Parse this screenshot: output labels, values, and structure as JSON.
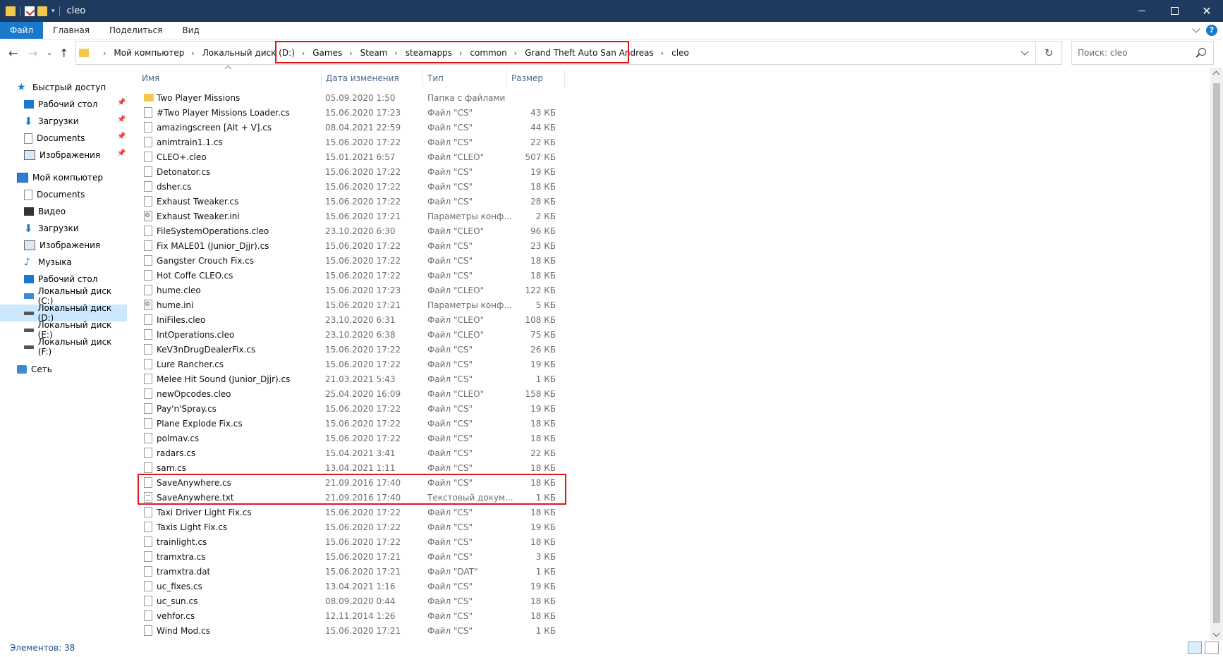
{
  "window": {
    "title": "cleo",
    "min_icon": "minimize-icon",
    "max_icon": "maximize-icon",
    "close_glyph": "✕"
  },
  "ribbon": {
    "tabs": [
      "Файл",
      "Главная",
      "Поделиться",
      "Вид"
    ]
  },
  "address": {
    "crumbs": [
      "Мой компьютер",
      "Локальный диск (D:)",
      "Games",
      "Steam",
      "steamapps",
      "common",
      "Grand Theft Auto San Andreas",
      "cleo"
    ],
    "refresh_glyph": "↻"
  },
  "search": {
    "placeholder": "Поиск: cleo"
  },
  "sidebar": {
    "quick_access": "Быстрый доступ",
    "quick_items": [
      {
        "label": "Рабочий стол",
        "icon": "desktop-icon"
      },
      {
        "label": "Загрузки",
        "icon": "downloads-icon"
      },
      {
        "label": "Documents",
        "icon": "documents-icon"
      },
      {
        "label": "Изображения",
        "icon": "pictures-icon"
      }
    ],
    "this_pc": "Мой компьютер",
    "pc_items": [
      {
        "label": "Documents",
        "icon": "documents-icon"
      },
      {
        "label": "Видео",
        "icon": "video-icon"
      },
      {
        "label": "Загрузки",
        "icon": "downloads-icon"
      },
      {
        "label": "Изображения",
        "icon": "pictures-icon"
      },
      {
        "label": "Музыка",
        "icon": "music-icon"
      },
      {
        "label": "Рабочий стол",
        "icon": "desktop-icon"
      },
      {
        "label": "Локальный диск (C:)",
        "icon": "drive-icon"
      },
      {
        "label": "Локальный диск (D:)",
        "icon": "drive-icon"
      },
      {
        "label": "Локальный диск (E:)",
        "icon": "drive-icon"
      },
      {
        "label": "Локальный диск (F:)",
        "icon": "drive-icon"
      }
    ],
    "network": "Сеть"
  },
  "columns": {
    "name": "Имя",
    "date": "Дата изменения",
    "type": "Тип",
    "size": "Размер"
  },
  "files": [
    {
      "name": "Two Player Missions",
      "date": "05.09.2020 1:50",
      "type": "Папка с файлами",
      "size": "",
      "kind": "folder"
    },
    {
      "name": "#Two Player Missions Loader.cs",
      "date": "15.06.2020 17:23",
      "type": "Файл \"CS\"",
      "size": "43 КБ",
      "kind": "file"
    },
    {
      "name": "amazingscreen [Alt + V].cs",
      "date": "08.04.2021 22:59",
      "type": "Файл \"CS\"",
      "size": "44 КБ",
      "kind": "file"
    },
    {
      "name": "animtrain1.1.cs",
      "date": "15.06.2020 17:22",
      "type": "Файл \"CS\"",
      "size": "22 КБ",
      "kind": "file"
    },
    {
      "name": "CLEO+.cleo",
      "date": "15.01.2021 6:57",
      "type": "Файл \"CLEO\"",
      "size": "507 КБ",
      "kind": "file"
    },
    {
      "name": "Detonator.cs",
      "date": "15.06.2020 17:22",
      "type": "Файл \"CS\"",
      "size": "19 КБ",
      "kind": "file"
    },
    {
      "name": "dsher.cs",
      "date": "15.06.2020 17:22",
      "type": "Файл \"CS\"",
      "size": "18 КБ",
      "kind": "file"
    },
    {
      "name": "Exhaust Tweaker.cs",
      "date": "15.06.2020 17:22",
      "type": "Файл \"CS\"",
      "size": "28 КБ",
      "kind": "file"
    },
    {
      "name": "Exhaust Tweaker.ini",
      "date": "15.06.2020 17:21",
      "type": "Параметры конф...",
      "size": "2 КБ",
      "kind": "ini"
    },
    {
      "name": "FileSystemOperations.cleo",
      "date": "23.10.2020 6:30",
      "type": "Файл \"CLEO\"",
      "size": "96 КБ",
      "kind": "file"
    },
    {
      "name": "Fix MALE01 (Junior_Djjr).cs",
      "date": "15.06.2020 17:22",
      "type": "Файл \"CS\"",
      "size": "23 КБ",
      "kind": "file"
    },
    {
      "name": "Gangster Crouch Fix.cs",
      "date": "15.06.2020 17:22",
      "type": "Файл \"CS\"",
      "size": "18 КБ",
      "kind": "file"
    },
    {
      "name": "Hot Coffe CLEO.cs",
      "date": "15.06.2020 17:22",
      "type": "Файл \"CS\"",
      "size": "18 КБ",
      "kind": "file"
    },
    {
      "name": "hume.cleo",
      "date": "15.06.2020 17:23",
      "type": "Файл \"CLEO\"",
      "size": "122 КБ",
      "kind": "file"
    },
    {
      "name": "hume.ini",
      "date": "15.06.2020 17:21",
      "type": "Параметры конф...",
      "size": "5 КБ",
      "kind": "ini"
    },
    {
      "name": "IniFiles.cleo",
      "date": "23.10.2020 6:31",
      "type": "Файл \"CLEO\"",
      "size": "108 КБ",
      "kind": "file"
    },
    {
      "name": "IntOperations.cleo",
      "date": "23.10.2020 6:38",
      "type": "Файл \"CLEO\"",
      "size": "75 КБ",
      "kind": "file"
    },
    {
      "name": "KeV3nDrugDealerFix.cs",
      "date": "15.06.2020 17:22",
      "type": "Файл \"CS\"",
      "size": "26 КБ",
      "kind": "file"
    },
    {
      "name": "Lure Rancher.cs",
      "date": "15.06.2020 17:22",
      "type": "Файл \"CS\"",
      "size": "19 КБ",
      "kind": "file"
    },
    {
      "name": "Melee Hit Sound (Junior_Djjr).cs",
      "date": "21.03.2021 5:43",
      "type": "Файл \"CS\"",
      "size": "1 КБ",
      "kind": "file"
    },
    {
      "name": "newOpcodes.cleo",
      "date": "25.04.2020 16:09",
      "type": "Файл \"CLEO\"",
      "size": "158 КБ",
      "kind": "file"
    },
    {
      "name": "Pay'n'Spray.cs",
      "date": "15.06.2020 17:22",
      "type": "Файл \"CS\"",
      "size": "19 КБ",
      "kind": "file"
    },
    {
      "name": "Plane Explode Fix.cs",
      "date": "15.06.2020 17:22",
      "type": "Файл \"CS\"",
      "size": "18 КБ",
      "kind": "file"
    },
    {
      "name": "polmav.cs",
      "date": "15.06.2020 17:22",
      "type": "Файл \"CS\"",
      "size": "18 КБ",
      "kind": "file"
    },
    {
      "name": "radars.cs",
      "date": "15.04.2021 3:41",
      "type": "Файл \"CS\"",
      "size": "22 КБ",
      "kind": "file"
    },
    {
      "name": "sam.cs",
      "date": "13.04.2021 1:11",
      "type": "Файл \"CS\"",
      "size": "18 КБ",
      "kind": "file"
    },
    {
      "name": "SaveAnywhere.cs",
      "date": "21.09.2016 17:40",
      "type": "Файл \"CS\"",
      "size": "18 КБ",
      "kind": "file"
    },
    {
      "name": "SaveAnywhere.txt",
      "date": "21.09.2016 17:40",
      "type": "Текстовый докум...",
      "size": "1 КБ",
      "kind": "txt"
    },
    {
      "name": "Taxi Driver Light Fix.cs",
      "date": "15.06.2020 17:22",
      "type": "Файл \"CS\"",
      "size": "18 КБ",
      "kind": "file"
    },
    {
      "name": "Taxis Light Fix.cs",
      "date": "15.06.2020 17:22",
      "type": "Файл \"CS\"",
      "size": "19 КБ",
      "kind": "file"
    },
    {
      "name": "trainlight.cs",
      "date": "15.06.2020 17:22",
      "type": "Файл \"CS\"",
      "size": "18 КБ",
      "kind": "file"
    },
    {
      "name": "tramxtra.cs",
      "date": "15.06.2020 17:21",
      "type": "Файл \"CS\"",
      "size": "3 КБ",
      "kind": "file"
    },
    {
      "name": "tramxtra.dat",
      "date": "15.06.2020 17:21",
      "type": "Файл \"DAT\"",
      "size": "1 КБ",
      "kind": "file"
    },
    {
      "name": "uc_fixes.cs",
      "date": "13.04.2021 1:16",
      "type": "Файл \"CS\"",
      "size": "19 КБ",
      "kind": "file"
    },
    {
      "name": "uc_sun.cs",
      "date": "08.09.2020 0:44",
      "type": "Файл \"CS\"",
      "size": "18 КБ",
      "kind": "file"
    },
    {
      "name": "vehfor.cs",
      "date": "12.11.2014 1:26",
      "type": "Файл \"CS\"",
      "size": "18 КБ",
      "kind": "file"
    },
    {
      "name": "Wind Mod.cs",
      "date": "15.06.2020 17:21",
      "type": "Файл \"CS\"",
      "size": "1 КБ",
      "kind": "file"
    }
  ],
  "status": {
    "items_count": "Элементов: 38"
  },
  "colors": {
    "titlebar": "#1f3a5f",
    "accent": "#1979ca",
    "highlight": "#e0161e",
    "selected": "#cce8ff"
  }
}
